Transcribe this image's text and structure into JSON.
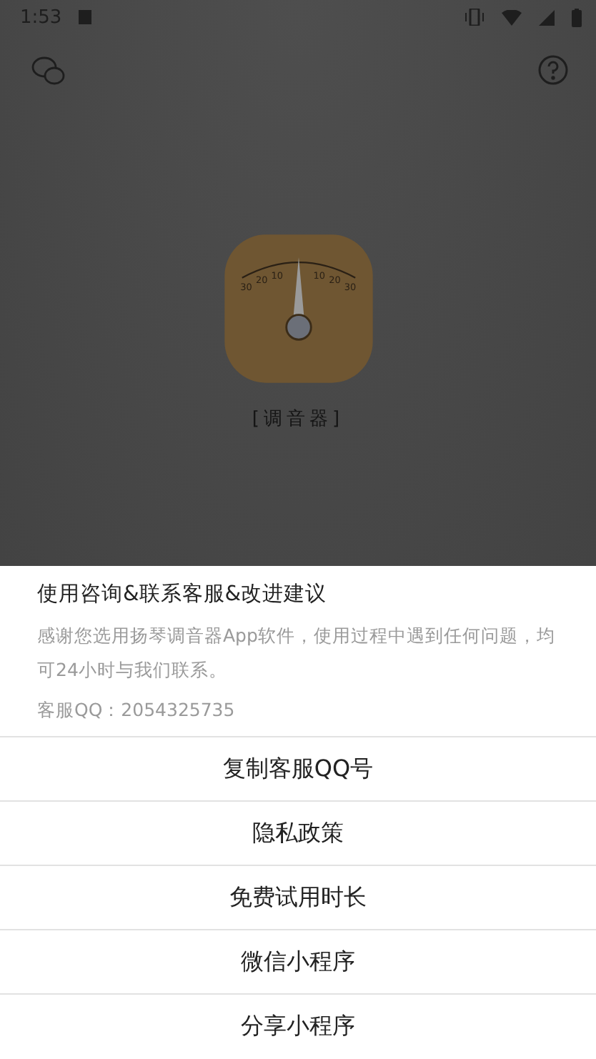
{
  "status_bar": {
    "time": "1:53"
  },
  "tuner": {
    "scale": [
      "30",
      "20",
      "10",
      "10",
      "20",
      "30"
    ],
    "label": "[调音器]"
  },
  "sheet": {
    "title": "使用咨询&联系客服&改进建议",
    "message": "感谢您选用扬琴调音器App软件，使用过程中遇到任何问题，均可24小时与我们联系。",
    "contact": "客服QQ：2054325735",
    "actions": [
      "复制客服QQ号",
      "隐私政策",
      "免费试用时长",
      "微信小程序",
      "分享小程序"
    ]
  }
}
